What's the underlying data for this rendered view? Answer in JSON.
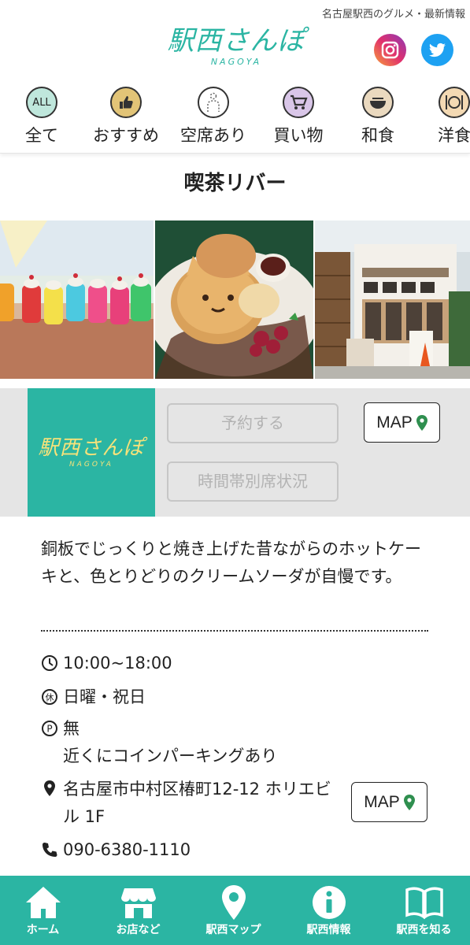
{
  "header": {
    "tagline": "名古屋駅西のグルメ・最新情報",
    "logo_main": "駅西さんぽ",
    "logo_sub": "NAGOYA"
  },
  "categories": [
    {
      "icon": "all-icon",
      "icon_text": "ALL",
      "label": "全て"
    },
    {
      "icon": "thumbs-up-icon",
      "label": "おすすめ"
    },
    {
      "icon": "vacancy-icon",
      "label": "空席あり"
    },
    {
      "icon": "cart-icon",
      "label": "買い物"
    },
    {
      "icon": "japanese-food-icon",
      "label": "和食"
    },
    {
      "icon": "western-food-icon",
      "label": "洋食"
    }
  ],
  "shop": {
    "title": "喫茶リバー",
    "photos": [
      "cream-sodas-photo",
      "pancake-photo",
      "storefront-photo"
    ],
    "panel_logo_main": "駅西さんぽ",
    "panel_logo_sub": "NAGOYA",
    "reserve_label": "予約する",
    "seat_status_label": "時間帯別席状況",
    "map_label": "MAP",
    "description": "銅板でじっくりと焼き上げた昔ながらのホットケーキと、色とりどりのクリームソーダが自慢です。",
    "hours": "10:00~18:00",
    "holiday": "日曜・祝日",
    "parking_line1": "無",
    "parking_line2": "近くにコインパーキングあり",
    "address_line1": "名古屋市中村区椿町12-12 ホリエビ",
    "address_line2": "ル 1F",
    "phone": "090-6380-1110"
  },
  "bottom_nav": [
    {
      "icon": "home-icon",
      "label": "ホーム"
    },
    {
      "icon": "store-icon",
      "label": "お店など"
    },
    {
      "icon": "map-pin-icon",
      "label": "駅西マップ"
    },
    {
      "icon": "info-icon",
      "label": "駅西情報"
    },
    {
      "icon": "book-icon",
      "label": "駅西を知る"
    }
  ],
  "colors": {
    "brand": "#2bb5a3",
    "logo_yellow": "#f6e27a",
    "pin_green": "#2f8f4f",
    "disabled": "#b3b3b3"
  }
}
